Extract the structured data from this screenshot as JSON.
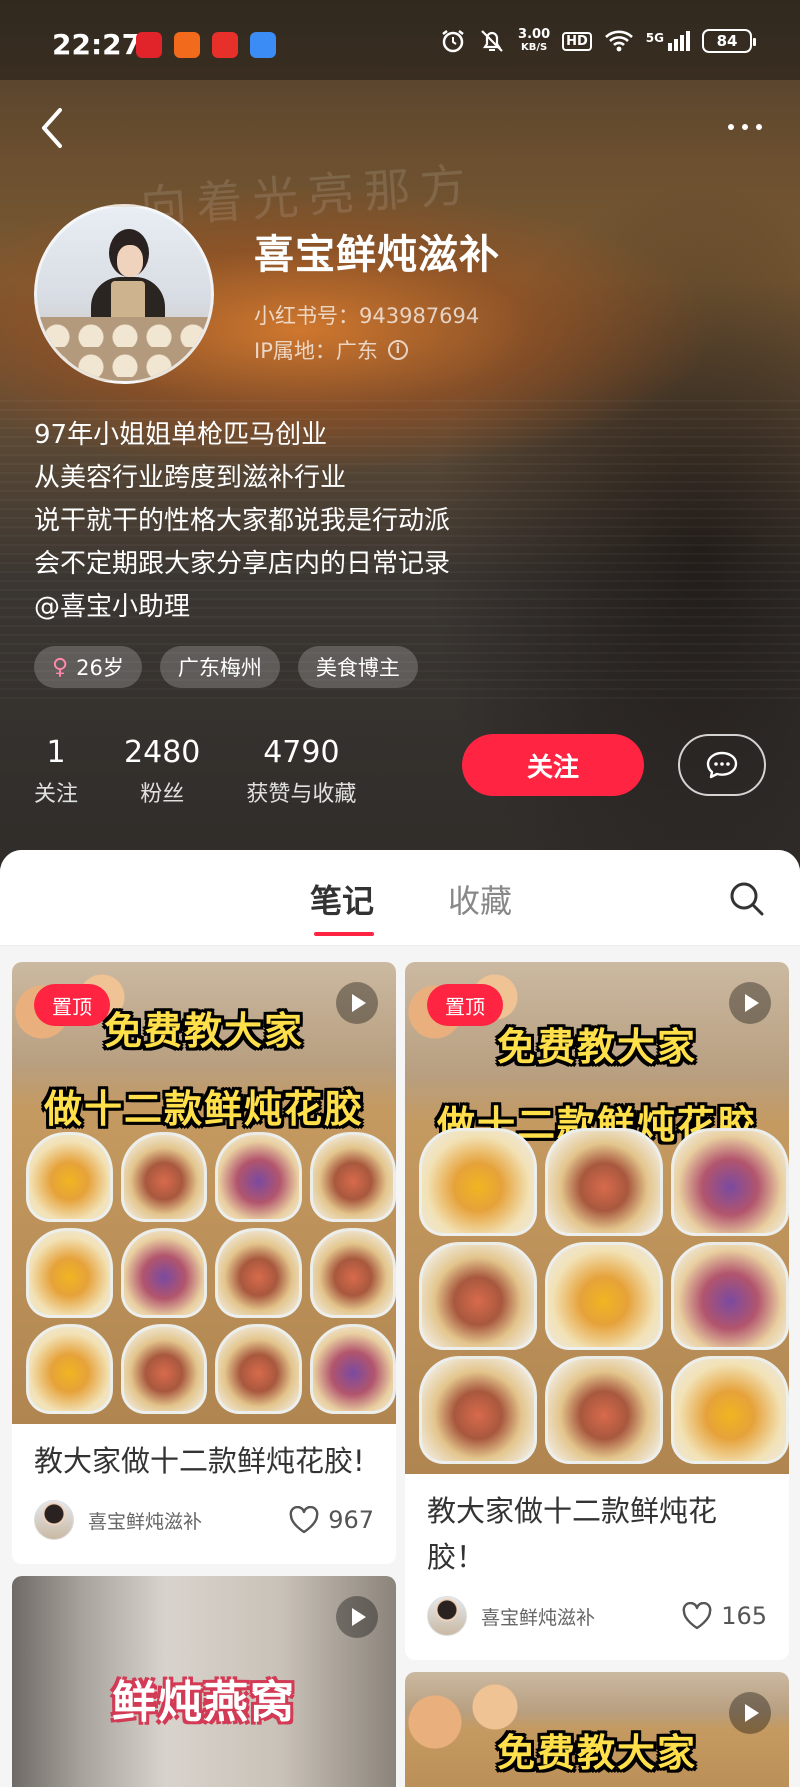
{
  "status_bar": {
    "time": "22:27",
    "net_speed_value": "3.00",
    "net_speed_unit": "KB/S",
    "hd": "HD",
    "signal": "5G",
    "battery": "84",
    "app_icon_colors": [
      "#e0242a",
      "#f26a1b",
      "#e8302a",
      "#3b8df5"
    ]
  },
  "nav": {
    "back_icon": "chevron-left-icon",
    "more_icon": "more-dots-icon"
  },
  "profile": {
    "handwriting": "向着光亮那方",
    "nickname": "喜宝鲜炖滋补",
    "id_line": "小红书号：943987694",
    "ip_line": "IP属地：广东",
    "bio": [
      "97年小姐姐单枪匹马创业",
      "从美容行业跨度到滋补行业",
      "说干就干的性格大家都说我是行动派",
      "会不定期跟大家分享店内的日常记录",
      "@喜宝小助理"
    ],
    "tags": [
      {
        "icon": "female-icon",
        "label": "26岁"
      },
      {
        "label": "广东梅州"
      },
      {
        "label": "美食博主"
      }
    ],
    "stats": [
      {
        "num": "1",
        "label": "关注"
      },
      {
        "num": "2480",
        "label": "粉丝"
      },
      {
        "num": "4790",
        "label": "获赞与收藏"
      }
    ],
    "follow_label": "关注",
    "accent_color": "#ff2442"
  },
  "tabs": {
    "items": [
      "笔记",
      "收藏"
    ],
    "active": 0
  },
  "notes": {
    "left": [
      {
        "pinned": "置顶",
        "cover_line1": "免费教大家",
        "cover_line2": "做十二款鲜炖花胶",
        "title": "教大家做十二款鲜炖花胶!",
        "author": "喜宝鲜炖滋补",
        "likes": "967"
      },
      {
        "cover_line1": "鲜炖燕窝"
      }
    ],
    "right": [
      {
        "pinned": "置顶",
        "cover_line1": "免费教大家",
        "cover_line2": "做十二款鲜炖花胶",
        "title": "教大家做十二款鲜炖花胶！",
        "author": "喜宝鲜炖滋补",
        "likes": "165"
      },
      {
        "cover_line1": "免费教大家"
      }
    ]
  }
}
